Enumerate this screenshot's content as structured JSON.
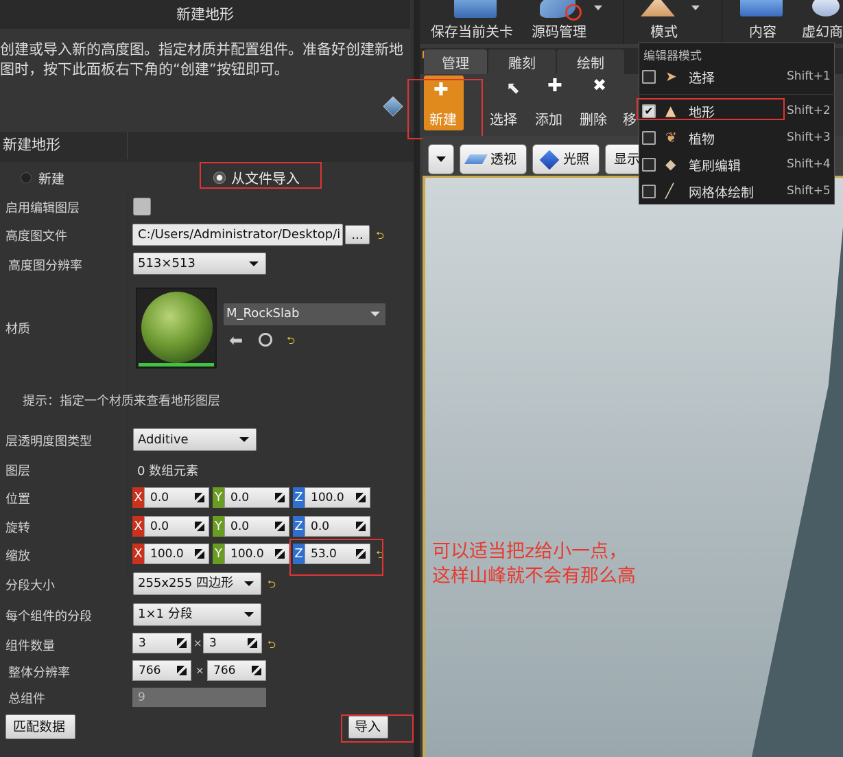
{
  "panel_title": "新建地形",
  "description": "创建或导入新的高度图。指定材质并配置组件。准备好创建新地图时，按下此面板右下角的“创建”按钮即可。",
  "section_title": "新建地形",
  "mode_options": {
    "new": "新建",
    "import": "从文件导入"
  },
  "fields": {
    "enable_edit_layers": "启用编辑图层",
    "heightmap_file_label": "高度图文件",
    "heightmap_file_value": "C:/Users/Administrator/Desktop/i",
    "browse_label": "...",
    "heightmap_res_label": "高度图分辨率",
    "heightmap_res_value": "513×513",
    "material_label": "材质",
    "material_value": "M_RockSlab",
    "hint": "提示：指定一个材质来查看地形图层",
    "layer_alpha_label": "层透明度图类型",
    "layer_alpha_value": "Additive",
    "layers_label": "图层",
    "layers_value": "0 数组元素",
    "location_label": "位置",
    "location": {
      "x": "0.0",
      "y": "0.0",
      "z": "100.0"
    },
    "rotation_label": "旋转",
    "rotation": {
      "x": "0.0",
      "y": "0.0",
      "z": "0.0"
    },
    "scale_label": "缩放",
    "scale": {
      "x": "100.0",
      "y": "100.0",
      "z": "53.0"
    },
    "section_size_label": "分段大小",
    "section_size_value": "255x255 四边形",
    "sections_per_comp_label": "每个组件的分段",
    "sections_per_comp_value": "1×1 分段",
    "num_components_label": "组件数量",
    "num_components": {
      "a": "3",
      "b": "3"
    },
    "overall_res_label": "整体分辨率",
    "overall_res": {
      "a": "766",
      "b": "766"
    },
    "total_components_label": "总组件",
    "total_components_value": "9",
    "times": "×"
  },
  "axis_labels": {
    "x": "X",
    "y": "Y",
    "z": "Z"
  },
  "buttons": {
    "fit_data": "匹配数据",
    "import": "导入"
  },
  "toolbar": {
    "save": "保存当前关卡",
    "source": "源码管理",
    "modes": "模式",
    "content": "内容",
    "marketplace": "虚幻商"
  },
  "tabs": [
    "管理",
    "雕刻",
    "绘制"
  ],
  "tools": {
    "new": "新建",
    "select": "选择",
    "add": "添加",
    "delete": "删除",
    "move": "移"
  },
  "viewport": {
    "perspective": "透视",
    "lit": "光照",
    "show": "显示"
  },
  "mode_menu": {
    "header": "编辑器模式",
    "items": [
      {
        "label": "选择",
        "shortcut": "Shift+1",
        "checked": false
      },
      {
        "label": "地形",
        "shortcut": "Shift+2",
        "checked": true
      },
      {
        "label": "植物",
        "shortcut": "Shift+3",
        "checked": false
      },
      {
        "label": "笔刷编辑",
        "shortcut": "Shift+4",
        "checked": false
      },
      {
        "label": "网格体绘制",
        "shortcut": "Shift+5",
        "checked": false
      }
    ]
  },
  "annotation": [
    "可以适当把z给小一点，",
    "这样山峰就不会有那么高"
  ],
  "colors": {
    "accent_orange": "#e08a1e",
    "annotation_red": "#e8392d"
  }
}
